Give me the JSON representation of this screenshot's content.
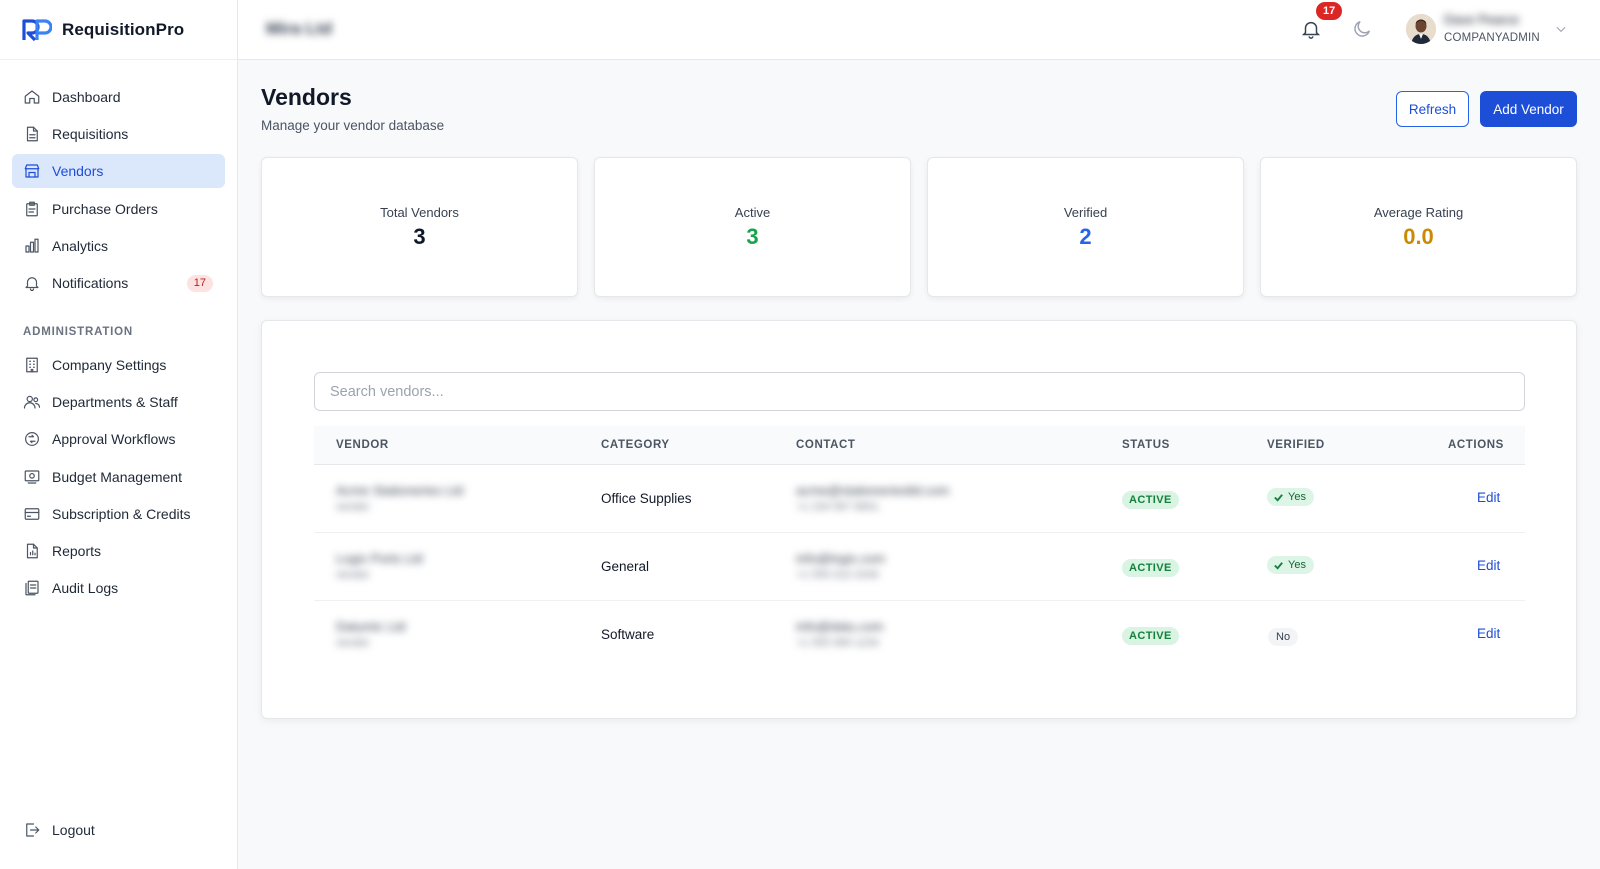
{
  "app": {
    "brand_name": "RequisitionPro",
    "brand_colors": {
      "primary": "#1d4ed8",
      "logo_light": "#60a5fa"
    }
  },
  "sidebar": {
    "items": [
      {
        "label": "Dashboard",
        "icon": "home-icon",
        "active": false
      },
      {
        "label": "Requisitions",
        "icon": "document-icon",
        "active": false
      },
      {
        "label": "Vendors",
        "icon": "building-icon",
        "active": true
      },
      {
        "label": "Purchase Orders",
        "icon": "clipboard-icon",
        "active": false
      },
      {
        "label": "Analytics",
        "icon": "bar-chart-icon",
        "active": false
      },
      {
        "label": "Notifications",
        "icon": "bell-icon",
        "active": false,
        "badge": "17"
      }
    ],
    "admin_section_label": "ADMINISTRATION",
    "admin_items": [
      {
        "label": "Company Settings",
        "icon": "office-building-icon"
      },
      {
        "label": "Departments & Staff",
        "icon": "users-icon"
      },
      {
        "label": "Approval Workflows",
        "icon": "workflow-icon"
      },
      {
        "label": "Budget Management",
        "icon": "budget-icon"
      },
      {
        "label": "Subscription & Credits",
        "icon": "credit-card-icon"
      },
      {
        "label": "Reports",
        "icon": "report-icon"
      },
      {
        "label": "Audit Logs",
        "icon": "audit-log-icon"
      }
    ],
    "logout_label": "Logout"
  },
  "topbar": {
    "company_name": "Mira Ltd",
    "notification_count": "17",
    "user_name": "Dave Pearce",
    "user_role": "COMPANYADMIN"
  },
  "page": {
    "title": "Vendors",
    "subtitle": "Manage your vendor database",
    "refresh_label": "Refresh",
    "add_vendor_label": "Add Vendor"
  },
  "stats": [
    {
      "label": "Total Vendors",
      "value": "3",
      "color": "#111827"
    },
    {
      "label": "Active",
      "value": "3",
      "color": "#16a34a"
    },
    {
      "label": "Verified",
      "value": "2",
      "color": "#2563eb"
    },
    {
      "label": "Average Rating",
      "value": "0.0",
      "color": "#ca8a04"
    }
  ],
  "search": {
    "placeholder": "Search vendors...",
    "value": ""
  },
  "table": {
    "columns": [
      "VENDOR",
      "CATEGORY",
      "CONTACT",
      "STATUS",
      "VERIFIED",
      "ACTIONS"
    ],
    "rows": [
      {
        "vendor": "Acme Stationeries Ltd",
        "vendor_sub": "vendor",
        "category": "Office Supplies",
        "contact": "acme@stationeriesltd.com",
        "contact_sub": "+1 234 567 8901",
        "status": "ACTIVE",
        "verified": "Yes",
        "action": "Edit"
      },
      {
        "vendor": "Logix Ports Ltd",
        "vendor_sub": "vendor",
        "category": "General",
        "contact": "info@logix.com",
        "contact_sub": "+1 555 010 2030",
        "status": "ACTIVE",
        "verified": "Yes",
        "action": "Edit"
      },
      {
        "vendor": "Datumic Ltd",
        "vendor_sub": "vendor",
        "category": "Software",
        "contact": "info@datu.com",
        "contact_sub": "+1 555 999 1234",
        "status": "ACTIVE",
        "verified": "No",
        "action": "Edit"
      }
    ]
  }
}
